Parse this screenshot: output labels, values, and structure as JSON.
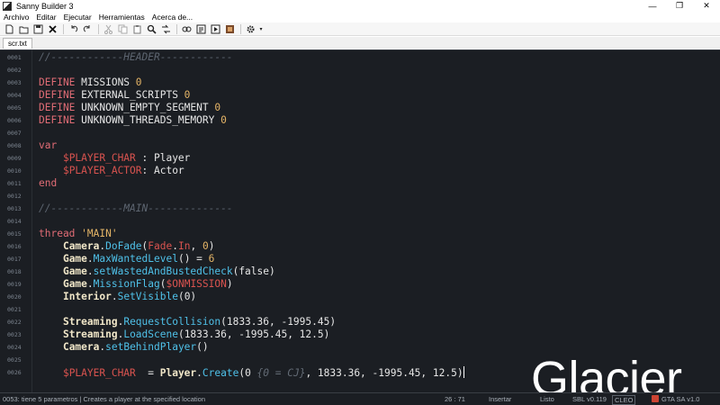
{
  "window": {
    "title": "Sanny Builder 3",
    "controls": [
      "—",
      "❐",
      "✕"
    ]
  },
  "menu": [
    "Archivo",
    "Editar",
    "Ejecutar",
    "Herramientas",
    "Acerca de..."
  ],
  "toolbar": {
    "icons": [
      "new-file-icon",
      "open-folder-icon",
      "save-icon",
      "close-icon",
      "undo-icon",
      "redo-icon",
      "cut-icon",
      "copy-icon",
      "paste-icon",
      "find-icon",
      "replace-icon",
      "compile-icon",
      "decompile-icon",
      "compile-run-icon",
      "game-icon",
      "settings-icon"
    ]
  },
  "tabs": [
    {
      "label": "scr.txt",
      "active": true
    }
  ],
  "editor": {
    "lines": [
      {
        "num": "0001",
        "tokens": [
          {
            "t": "//------------HEADER------------",
            "c": "comment"
          }
        ]
      },
      {
        "num": "0002",
        "tokens": []
      },
      {
        "num": "0003",
        "tokens": [
          {
            "t": "DEFINE ",
            "c": "kw"
          },
          {
            "t": "MISSIONS ",
            "c": "id"
          },
          {
            "t": "0",
            "c": "num"
          }
        ]
      },
      {
        "num": "0004",
        "tokens": [
          {
            "t": "DEFINE ",
            "c": "kw"
          },
          {
            "t": "EXTERNAL_SCRIPTS ",
            "c": "id"
          },
          {
            "t": "0",
            "c": "num"
          }
        ]
      },
      {
        "num": "0005",
        "tokens": [
          {
            "t": "DEFINE ",
            "c": "kw"
          },
          {
            "t": "UNKNOWN_EMPTY_SEGMENT ",
            "c": "id"
          },
          {
            "t": "0",
            "c": "num"
          }
        ]
      },
      {
        "num": "0006",
        "tokens": [
          {
            "t": "DEFINE ",
            "c": "kw"
          },
          {
            "t": "UNKNOWN_THREADS_MEMORY ",
            "c": "id"
          },
          {
            "t": "0",
            "c": "num"
          }
        ]
      },
      {
        "num": "0007",
        "tokens": []
      },
      {
        "num": "0008",
        "tokens": [
          {
            "t": "var",
            "c": "kw"
          }
        ]
      },
      {
        "num": "0009",
        "tokens": [
          {
            "t": "    ",
            "c": "id"
          },
          {
            "t": "$PLAYER_CHAR",
            "c": "var"
          },
          {
            "t": " : Player",
            "c": "type"
          }
        ]
      },
      {
        "num": "0010",
        "tokens": [
          {
            "t": "    ",
            "c": "id"
          },
          {
            "t": "$PLAYER_ACTOR",
            "c": "var"
          },
          {
            "t": ": Actor",
            "c": "type"
          }
        ]
      },
      {
        "num": "0011",
        "tokens": [
          {
            "t": "end",
            "c": "kw"
          }
        ]
      },
      {
        "num": "0012",
        "tokens": []
      },
      {
        "num": "0013",
        "tokens": [
          {
            "t": "//------------MAIN--------------",
            "c": "comment"
          }
        ]
      },
      {
        "num": "0014",
        "tokens": []
      },
      {
        "num": "0015",
        "tokens": [
          {
            "t": "thread ",
            "c": "kw"
          },
          {
            "t": "'MAIN'",
            "c": "str"
          }
        ]
      },
      {
        "num": "0016",
        "tokens": [
          {
            "t": "    ",
            "c": "id"
          },
          {
            "t": "Camera",
            "c": "class"
          },
          {
            "t": ".",
            "c": "punct"
          },
          {
            "t": "DoFade",
            "c": "method"
          },
          {
            "t": "(",
            "c": "punct"
          },
          {
            "t": "Fade",
            "c": "var"
          },
          {
            "t": ".",
            "c": "punct"
          },
          {
            "t": "In",
            "c": "var"
          },
          {
            "t": ", ",
            "c": "punct"
          },
          {
            "t": "0",
            "c": "num"
          },
          {
            "t": ")",
            "c": "punct"
          }
        ]
      },
      {
        "num": "0017",
        "tokens": [
          {
            "t": "    ",
            "c": "id"
          },
          {
            "t": "Game",
            "c": "class"
          },
          {
            "t": ".",
            "c": "punct"
          },
          {
            "t": "MaxWantedLevel",
            "c": "method"
          },
          {
            "t": "() = ",
            "c": "punct"
          },
          {
            "t": "6",
            "c": "num"
          }
        ]
      },
      {
        "num": "0018",
        "tokens": [
          {
            "t": "    ",
            "c": "id"
          },
          {
            "t": "Game",
            "c": "class"
          },
          {
            "t": ".",
            "c": "punct"
          },
          {
            "t": "setWastedAndBustedCheck",
            "c": "method"
          },
          {
            "t": "(false)",
            "c": "punct"
          }
        ]
      },
      {
        "num": "0019",
        "tokens": [
          {
            "t": "    ",
            "c": "id"
          },
          {
            "t": "Game",
            "c": "class"
          },
          {
            "t": ".",
            "c": "punct"
          },
          {
            "t": "MissionFlag",
            "c": "method"
          },
          {
            "t": "(",
            "c": "punct"
          },
          {
            "t": "$ONMISSION",
            "c": "var"
          },
          {
            "t": ")",
            "c": "punct"
          }
        ]
      },
      {
        "num": "0020",
        "tokens": [
          {
            "t": "    ",
            "c": "id"
          },
          {
            "t": "Interior",
            "c": "class"
          },
          {
            "t": ".",
            "c": "punct"
          },
          {
            "t": "SetVisible",
            "c": "method"
          },
          {
            "t": "(0)",
            "c": "punct"
          }
        ]
      },
      {
        "num": "0021",
        "tokens": []
      },
      {
        "num": "0022",
        "tokens": [
          {
            "t": "    ",
            "c": "id"
          },
          {
            "t": "Streaming",
            "c": "class"
          },
          {
            "t": ".",
            "c": "punct"
          },
          {
            "t": "RequestCollision",
            "c": "method"
          },
          {
            "t": "(1833.36, -1995.45)",
            "c": "punct"
          }
        ]
      },
      {
        "num": "0023",
        "tokens": [
          {
            "t": "    ",
            "c": "id"
          },
          {
            "t": "Streaming",
            "c": "class"
          },
          {
            "t": ".",
            "c": "punct"
          },
          {
            "t": "LoadScene",
            "c": "method"
          },
          {
            "t": "(1833.36, -1995.45, 12.5)",
            "c": "punct"
          }
        ]
      },
      {
        "num": "0024",
        "tokens": [
          {
            "t": "    ",
            "c": "id"
          },
          {
            "t": "Camera",
            "c": "class"
          },
          {
            "t": ".",
            "c": "punct"
          },
          {
            "t": "setBehindPlayer",
            "c": "method"
          },
          {
            "t": "()",
            "c": "punct"
          }
        ]
      },
      {
        "num": "0025",
        "tokens": []
      },
      {
        "num": "0026",
        "tokens": [
          {
            "t": "    ",
            "c": "id"
          },
          {
            "t": "$PLAYER_CHAR",
            "c": "var"
          },
          {
            "t": "  = ",
            "c": "punct"
          },
          {
            "t": "Player",
            "c": "class"
          },
          {
            "t": ".",
            "c": "punct"
          },
          {
            "t": "Create",
            "c": "method"
          },
          {
            "t": "(0 ",
            "c": "punct"
          },
          {
            "t": "{0 = CJ}",
            "c": "inline-comment"
          },
          {
            "t": ", 1833.36, -1995.45, 12.5)",
            "c": "punct"
          }
        ]
      }
    ],
    "theme_label": "Glacier"
  },
  "status": {
    "message": "0053: tiene 5 parametros  |  Creates a player at the specified location",
    "position": "26 : 71",
    "mode": "Insertar",
    "state": "Listo",
    "sbl_version": "SBL v0.119",
    "cleo": "CLEO",
    "game": "GTA SA v1.0"
  },
  "colors": {
    "editor_bg": "#1b1e23",
    "keyword": "#e06c75",
    "number": "#e5b567",
    "method": "#4fc1e9",
    "variable": "#d9534f",
    "comment": "#5d6570"
  }
}
